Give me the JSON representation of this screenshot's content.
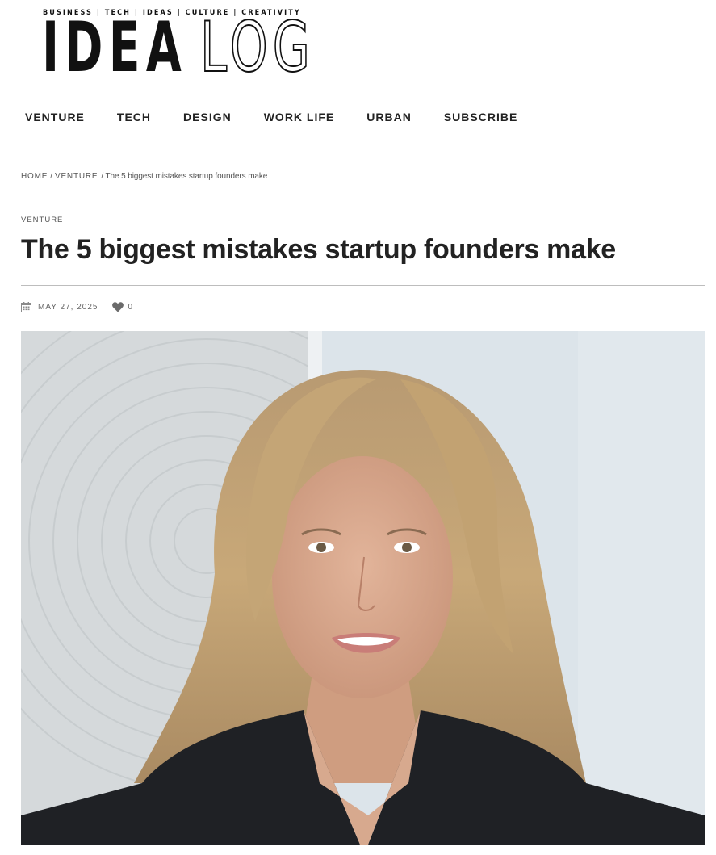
{
  "logo": {
    "tagline": "BUSINESS | TECH | IDEAS | CULTURE | CREATIVITY",
    "name_solid": "IDEA",
    "name_outline": "LOG"
  },
  "nav": {
    "items": [
      {
        "label": "VENTURE"
      },
      {
        "label": "TECH"
      },
      {
        "label": "DESIGN"
      },
      {
        "label": "WORK LIFE"
      },
      {
        "label": "URBAN"
      },
      {
        "label": "SUBSCRIBE"
      }
    ]
  },
  "breadcrumb": {
    "home": "HOME",
    "separator": "/",
    "section": "VENTURE",
    "current": "/ The 5 biggest mistakes startup founders make"
  },
  "article": {
    "category": "VENTURE",
    "title": "The 5 biggest mistakes startup founders make",
    "date": "MAY 27, 2025",
    "likes": "0"
  },
  "colors": {
    "text": "#222222",
    "muted": "#666666",
    "divider": "#bdbdbd"
  },
  "icons": {
    "date": "calendar-icon",
    "likes": "heart-icon"
  }
}
